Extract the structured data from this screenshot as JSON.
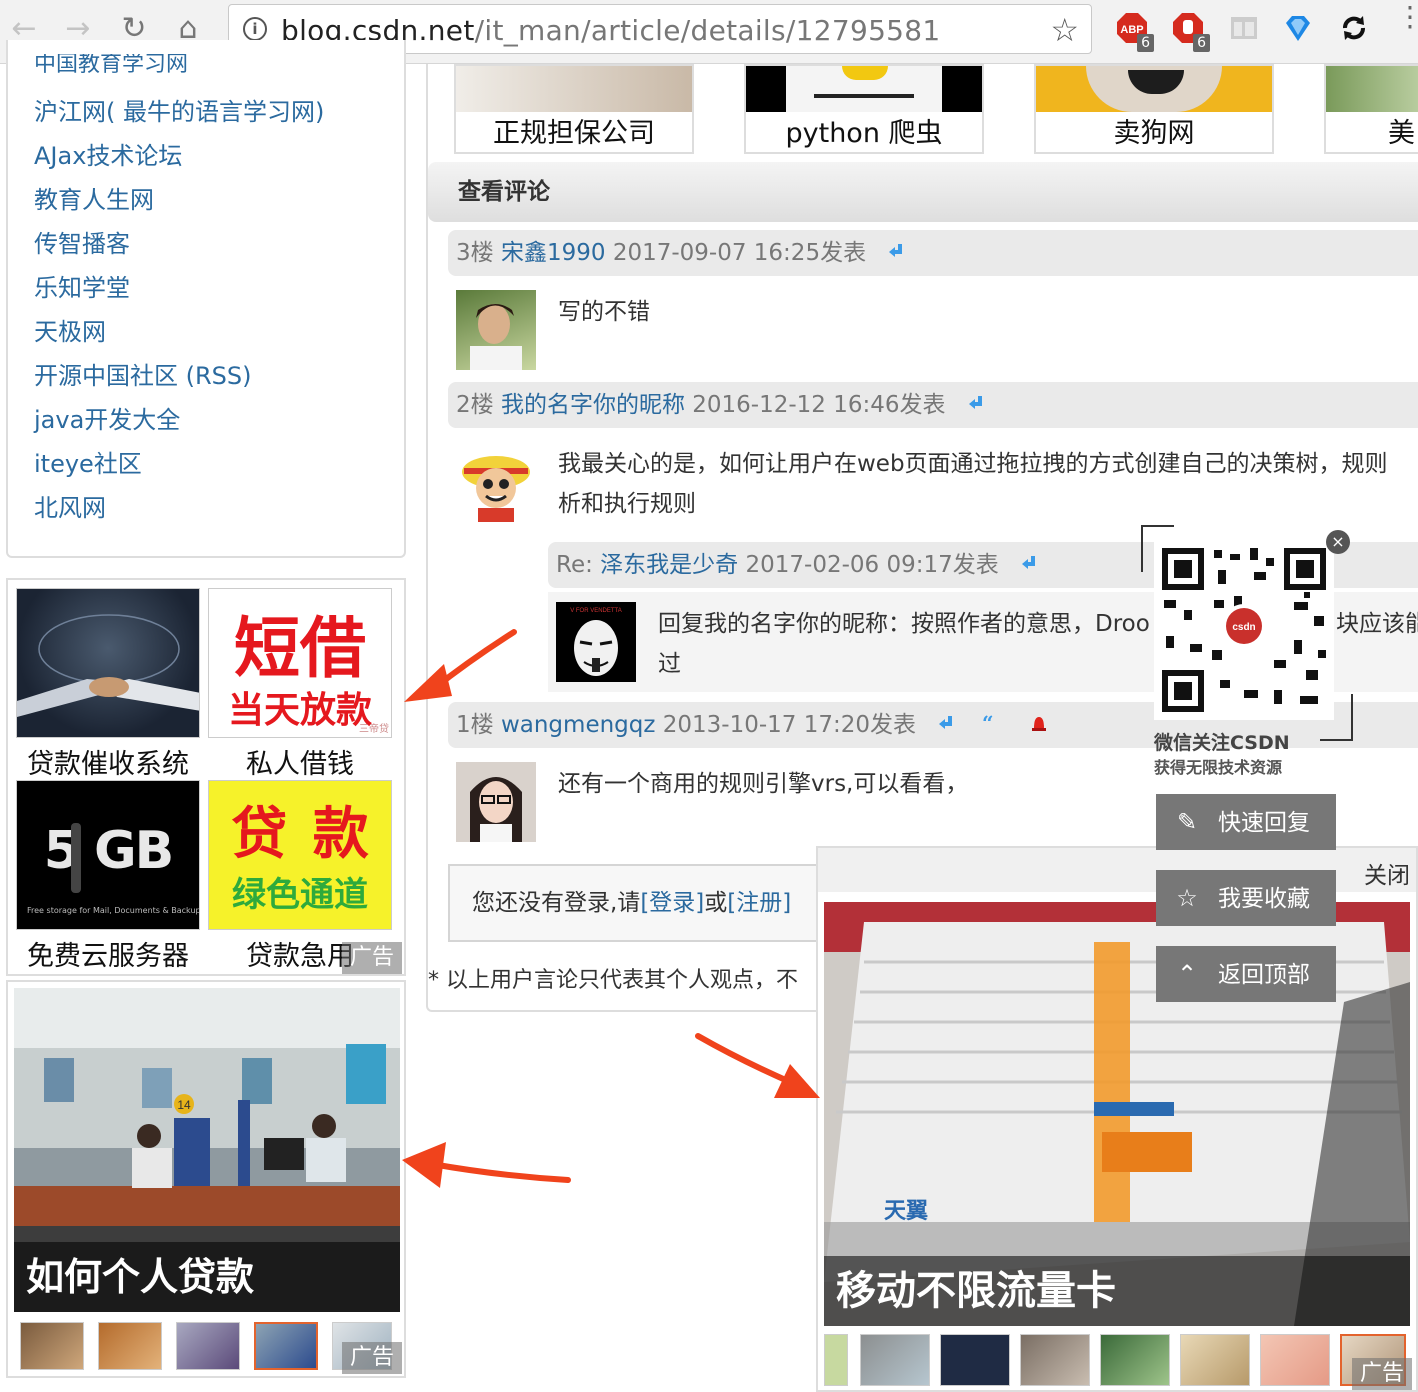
{
  "browser": {
    "url_host": "blog.csdn.net",
    "url_path": "/it_man/article/details/12795581",
    "ext_badges": [
      "6",
      "6"
    ]
  },
  "icons": [
    "back-icon",
    "forward-icon",
    "reload-icon",
    "home-icon",
    "info-icon",
    "bookmark-star-icon",
    "adblock-icon",
    "stop-icon",
    "reader-icon",
    "shield-icon",
    "sync-icon",
    "menu-icon"
  ],
  "sidebar": {
    "clipped_link": "中国教育学习网",
    "links": [
      "沪江网( 最牛的语言学习网)",
      "AJax技术论坛",
      "教育人生网",
      "传智播客",
      "乐知学堂",
      "天极网",
      "开源中国社区 (RSS)",
      "java开发大全",
      "iteye社区",
      "北风网"
    ]
  },
  "ads_grid": {
    "items": [
      {
        "label": "贷款催收系统",
        "img_text": ""
      },
      {
        "label": "私人借钱",
        "img_text": "短借",
        "img_sub": "当天放款",
        "img_tiny": "三帝贷"
      },
      {
        "label": "免费云服务器",
        "img_text": "5 GB",
        "img_sub": "Free storage for Mail, Documents & Backup"
      },
      {
        "label": "贷款急用",
        "img_text": "贷 款",
        "img_sub": "绿色通道"
      }
    ],
    "ad_tag": "广告"
  },
  "ad_slide_left": {
    "caption": "如何个人贷款",
    "ad_tag": "广告",
    "sign": "14"
  },
  "top_ads": [
    "正规担保公司",
    "python 爬虫",
    "卖狗网",
    "美"
  ],
  "comments_header": "查看评论",
  "comments": [
    {
      "floor": "3楼",
      "user": "宋鑫1990",
      "time": "2017-09-07 16:25发表",
      "body": [
        "写的不错"
      ]
    },
    {
      "floor": "2楼",
      "user": "我的名字你的昵称",
      "time": "2016-12-12 16:46发表",
      "body": [
        "我最关心的是，如何让用户在web页面通过拖拉拽的方式创建自己的决策树，规则",
        "析和执行规则"
      ]
    },
    {
      "floor": "Re:",
      "user": "泽东我是少奇",
      "time": "2017-02-06 09:17发表",
      "body": [
        "回复我的名字你的昵称：按照作者的意思，Droo",
        "过"
      ],
      "body_tail": "块应该能",
      "avatar_text": "V FOR VENDETTA"
    },
    {
      "floor": "1楼",
      "user": "wangmengqz",
      "time": "2013-10-17 17:20发表",
      "body": [
        "还有一个商用的规则引擎vrs,可以看看，"
      ]
    }
  ],
  "login": {
    "prefix": "您还没有登录,请",
    "login_link": "[登录]",
    "or": "或",
    "register_link": "[注册]"
  },
  "disclaimer": "* 以上用户言论只代表其个人观点，不",
  "qr": {
    "title": "微信关注CSDN",
    "subtitle": "获得无限技术资源",
    "close": "×",
    "logo": "csdn"
  },
  "side_buttons": [
    {
      "label": "快速回复",
      "icon": "pencil-icon"
    },
    {
      "label": "我要收藏",
      "icon": "star-icon"
    },
    {
      "label": "返回顶部",
      "icon": "up-arrow-icon"
    }
  ],
  "popup_ad": {
    "close": "关闭",
    "caption": "移动不限流量卡",
    "ad_tag": "广告",
    "card_text": "天翼"
  },
  "colors": {
    "link": "#2b6a9f",
    "arrow": "#f0431c",
    "button_bg": "#777777"
  }
}
